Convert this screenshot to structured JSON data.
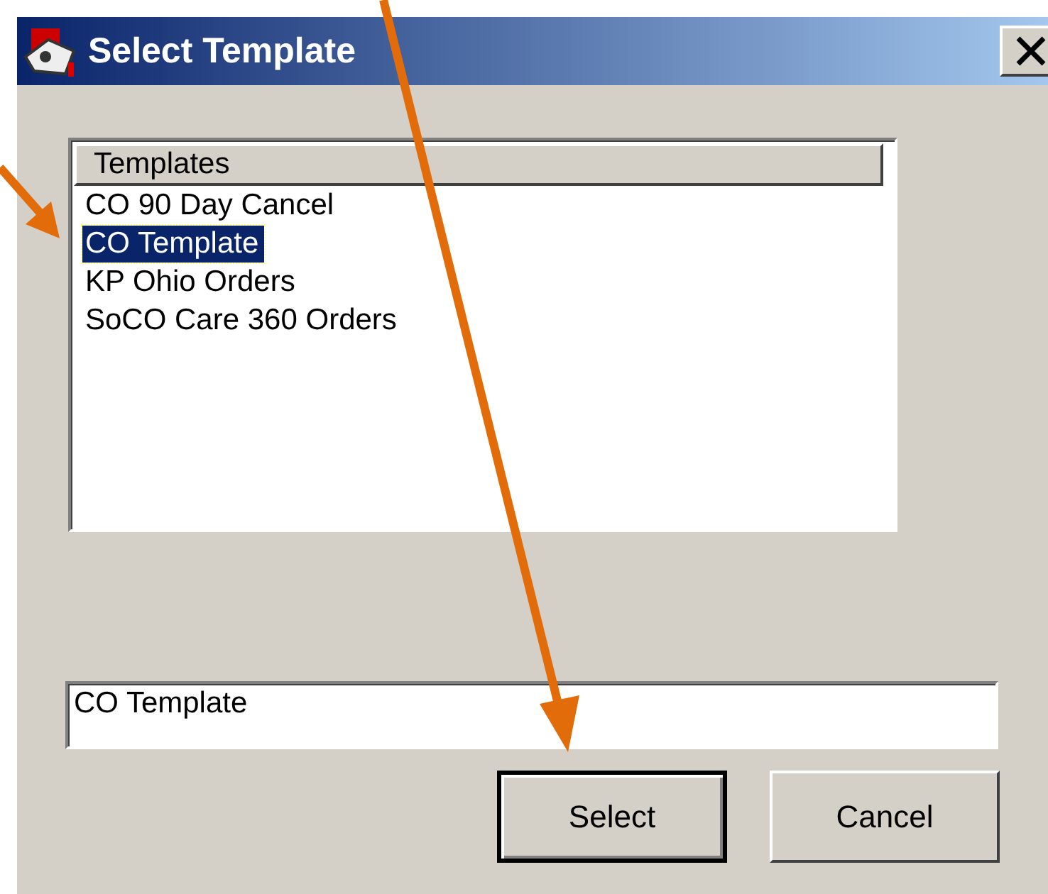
{
  "window": {
    "title": "Select Template"
  },
  "list": {
    "column": "Templates",
    "items": [
      {
        "label": "CO 90 Day Cancel",
        "selected": false
      },
      {
        "label": "CO Template",
        "selected": true
      },
      {
        "label": "KP Ohio Orders",
        "selected": false
      },
      {
        "label": "SoCO Care 360 Orders",
        "selected": false
      }
    ]
  },
  "name_field": {
    "value": "CO Template"
  },
  "buttons": [
    {
      "label": "Select",
      "default": true
    },
    {
      "label": "Cancel",
      "default": false
    }
  ]
}
